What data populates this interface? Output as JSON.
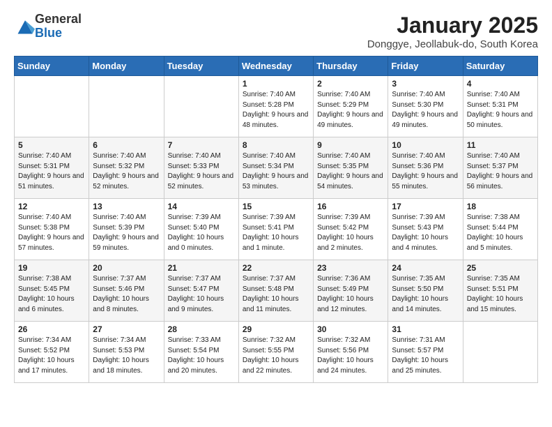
{
  "logo": {
    "general": "General",
    "blue": "Blue"
  },
  "title": "January 2025",
  "subtitle": "Donggye, Jeollabuk-do, South Korea",
  "headers": [
    "Sunday",
    "Monday",
    "Tuesday",
    "Wednesday",
    "Thursday",
    "Friday",
    "Saturday"
  ],
  "weeks": [
    [
      {
        "day": "",
        "info": ""
      },
      {
        "day": "",
        "info": ""
      },
      {
        "day": "",
        "info": ""
      },
      {
        "day": "1",
        "info": "Sunrise: 7:40 AM\nSunset: 5:28 PM\nDaylight: 9 hours\nand 48 minutes."
      },
      {
        "day": "2",
        "info": "Sunrise: 7:40 AM\nSunset: 5:29 PM\nDaylight: 9 hours\nand 49 minutes."
      },
      {
        "day": "3",
        "info": "Sunrise: 7:40 AM\nSunset: 5:30 PM\nDaylight: 9 hours\nand 49 minutes."
      },
      {
        "day": "4",
        "info": "Sunrise: 7:40 AM\nSunset: 5:31 PM\nDaylight: 9 hours\nand 50 minutes."
      }
    ],
    [
      {
        "day": "5",
        "info": "Sunrise: 7:40 AM\nSunset: 5:31 PM\nDaylight: 9 hours\nand 51 minutes."
      },
      {
        "day": "6",
        "info": "Sunrise: 7:40 AM\nSunset: 5:32 PM\nDaylight: 9 hours\nand 52 minutes."
      },
      {
        "day": "7",
        "info": "Sunrise: 7:40 AM\nSunset: 5:33 PM\nDaylight: 9 hours\nand 52 minutes."
      },
      {
        "day": "8",
        "info": "Sunrise: 7:40 AM\nSunset: 5:34 PM\nDaylight: 9 hours\nand 53 minutes."
      },
      {
        "day": "9",
        "info": "Sunrise: 7:40 AM\nSunset: 5:35 PM\nDaylight: 9 hours\nand 54 minutes."
      },
      {
        "day": "10",
        "info": "Sunrise: 7:40 AM\nSunset: 5:36 PM\nDaylight: 9 hours\nand 55 minutes."
      },
      {
        "day": "11",
        "info": "Sunrise: 7:40 AM\nSunset: 5:37 PM\nDaylight: 9 hours\nand 56 minutes."
      }
    ],
    [
      {
        "day": "12",
        "info": "Sunrise: 7:40 AM\nSunset: 5:38 PM\nDaylight: 9 hours\nand 57 minutes."
      },
      {
        "day": "13",
        "info": "Sunrise: 7:40 AM\nSunset: 5:39 PM\nDaylight: 9 hours\nand 59 minutes."
      },
      {
        "day": "14",
        "info": "Sunrise: 7:39 AM\nSunset: 5:40 PM\nDaylight: 10 hours\nand 0 minutes."
      },
      {
        "day": "15",
        "info": "Sunrise: 7:39 AM\nSunset: 5:41 PM\nDaylight: 10 hours\nand 1 minute."
      },
      {
        "day": "16",
        "info": "Sunrise: 7:39 AM\nSunset: 5:42 PM\nDaylight: 10 hours\nand 2 minutes."
      },
      {
        "day": "17",
        "info": "Sunrise: 7:39 AM\nSunset: 5:43 PM\nDaylight: 10 hours\nand 4 minutes."
      },
      {
        "day": "18",
        "info": "Sunrise: 7:38 AM\nSunset: 5:44 PM\nDaylight: 10 hours\nand 5 minutes."
      }
    ],
    [
      {
        "day": "19",
        "info": "Sunrise: 7:38 AM\nSunset: 5:45 PM\nDaylight: 10 hours\nand 6 minutes."
      },
      {
        "day": "20",
        "info": "Sunrise: 7:37 AM\nSunset: 5:46 PM\nDaylight: 10 hours\nand 8 minutes."
      },
      {
        "day": "21",
        "info": "Sunrise: 7:37 AM\nSunset: 5:47 PM\nDaylight: 10 hours\nand 9 minutes."
      },
      {
        "day": "22",
        "info": "Sunrise: 7:37 AM\nSunset: 5:48 PM\nDaylight: 10 hours\nand 11 minutes."
      },
      {
        "day": "23",
        "info": "Sunrise: 7:36 AM\nSunset: 5:49 PM\nDaylight: 10 hours\nand 12 minutes."
      },
      {
        "day": "24",
        "info": "Sunrise: 7:35 AM\nSunset: 5:50 PM\nDaylight: 10 hours\nand 14 minutes."
      },
      {
        "day": "25",
        "info": "Sunrise: 7:35 AM\nSunset: 5:51 PM\nDaylight: 10 hours\nand 15 minutes."
      }
    ],
    [
      {
        "day": "26",
        "info": "Sunrise: 7:34 AM\nSunset: 5:52 PM\nDaylight: 10 hours\nand 17 minutes."
      },
      {
        "day": "27",
        "info": "Sunrise: 7:34 AM\nSunset: 5:53 PM\nDaylight: 10 hours\nand 18 minutes."
      },
      {
        "day": "28",
        "info": "Sunrise: 7:33 AM\nSunset: 5:54 PM\nDaylight: 10 hours\nand 20 minutes."
      },
      {
        "day": "29",
        "info": "Sunrise: 7:32 AM\nSunset: 5:55 PM\nDaylight: 10 hours\nand 22 minutes."
      },
      {
        "day": "30",
        "info": "Sunrise: 7:32 AM\nSunset: 5:56 PM\nDaylight: 10 hours\nand 24 minutes."
      },
      {
        "day": "31",
        "info": "Sunrise: 7:31 AM\nSunset: 5:57 PM\nDaylight: 10 hours\nand 25 minutes."
      },
      {
        "day": "",
        "info": ""
      }
    ]
  ]
}
